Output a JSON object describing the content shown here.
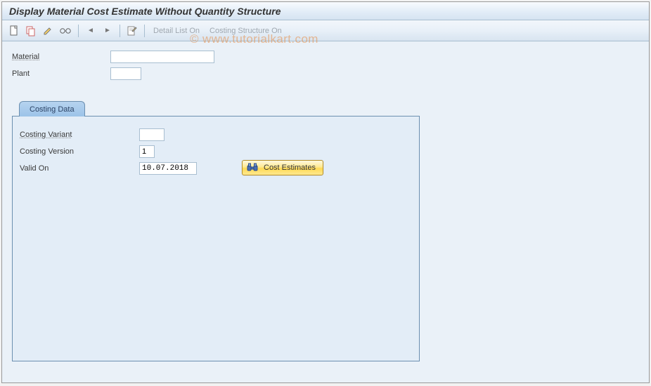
{
  "header": {
    "title": "Display Material Cost Estimate Without Quantity Structure"
  },
  "toolbar": {
    "detail_list_label": "Detail List On",
    "costing_struct_label": "Costing Structure On"
  },
  "top_fields": {
    "material_label": "Material",
    "material_value": "",
    "plant_label": "Plant",
    "plant_value": ""
  },
  "tab": {
    "label": "Costing Data"
  },
  "costing": {
    "variant_label": "Costing Variant",
    "variant_value": "",
    "version_label": "Costing Version",
    "version_value": "1",
    "valid_on_label": "Valid On",
    "valid_on_value": "10.07.2018",
    "cost_estimates_btn": "Cost Estimates"
  },
  "watermark": "© www.tutorialkart.com"
}
